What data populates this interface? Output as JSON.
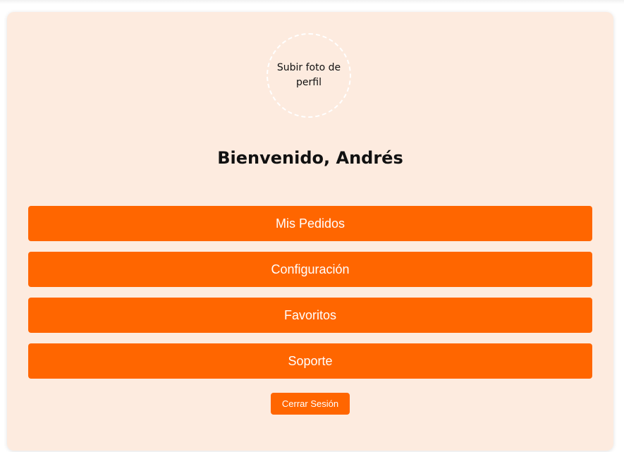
{
  "profile": {
    "upload_photo_label": "Subir foto de perfil",
    "welcome_text": "Bienvenido, Andrés"
  },
  "menu": {
    "items": [
      {
        "label": "Mis Pedidos"
      },
      {
        "label": "Configuración"
      },
      {
        "label": "Favoritos"
      },
      {
        "label": "Soporte"
      }
    ]
  },
  "logout": {
    "label": "Cerrar Sesión"
  },
  "colors": {
    "card_background": "#fdebdf",
    "accent": "#ff6600",
    "button_text": "#ffffff"
  }
}
